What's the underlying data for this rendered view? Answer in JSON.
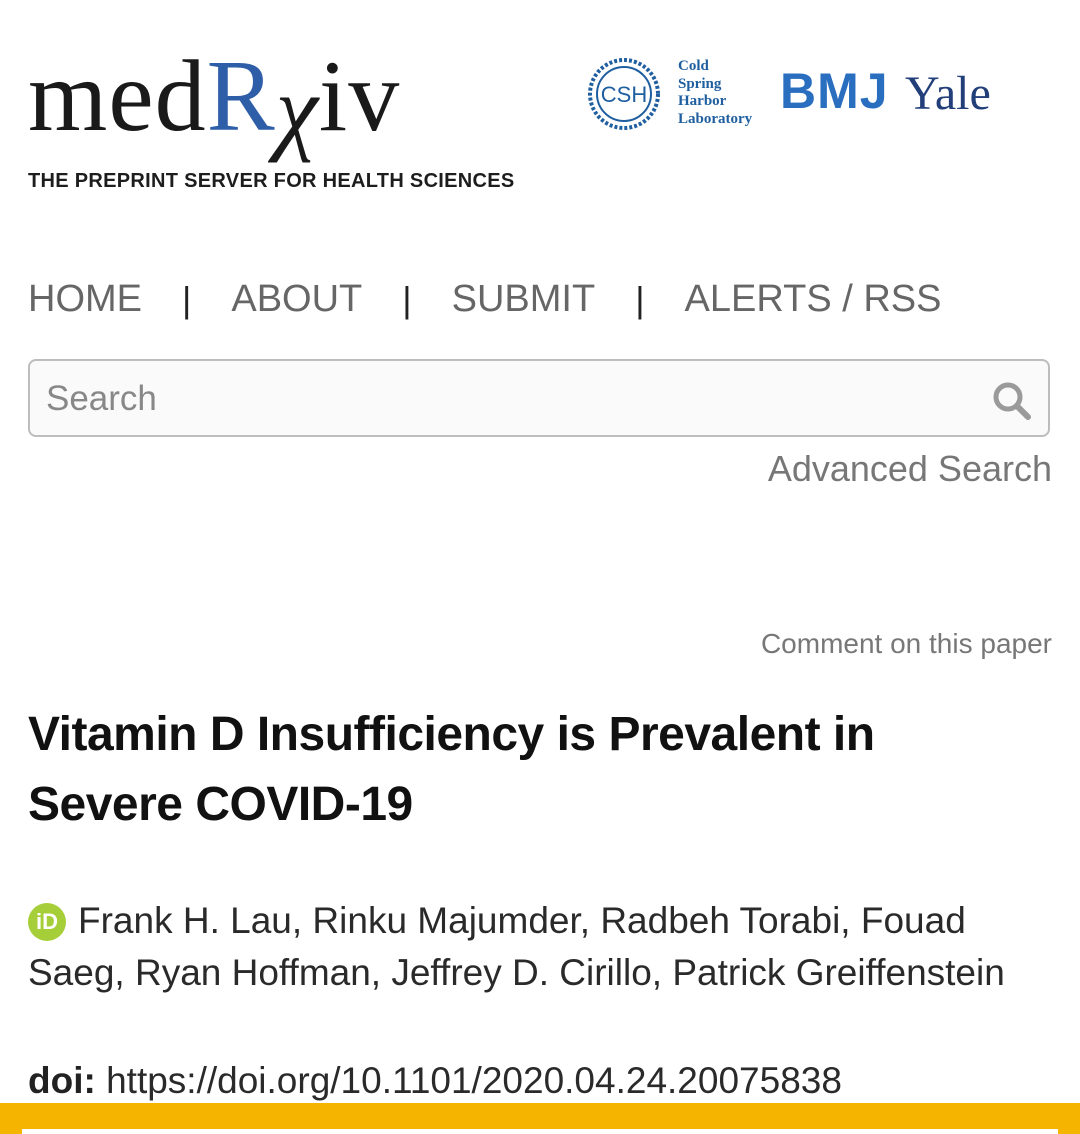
{
  "header": {
    "logo": {
      "med": "med",
      "r": "R",
      "chi": "χ",
      "iv": "iv"
    },
    "tagline": "THE PREPRINT SERVER FOR HEALTH SCIENCES",
    "csh_badge": "CSH",
    "csh_lines": [
      "Cold",
      "Spring",
      "Harbor",
      "Laboratory"
    ],
    "bmj": "BMJ",
    "yale": "Yale"
  },
  "nav": {
    "items": [
      "HOME",
      "ABOUT",
      "SUBMIT",
      "ALERTS / RSS"
    ],
    "separator": "|"
  },
  "search": {
    "placeholder": "Search",
    "value": "",
    "icon": "search-icon",
    "advanced_label": "Advanced Search"
  },
  "paper": {
    "comment_link": "Comment on this paper",
    "title": "Vitamin D Insufficiency is Prevalent in Severe COVID-19",
    "orcid_icon": "iD",
    "authors": "Frank H. Lau, Rinku Majumder, Radbeh Torabi, Fouad Saeg, Ryan Hoffman, Jeffrey D. Cirillo, Patrick Greiffenstein",
    "doi_label": "doi:",
    "doi_value": "https://doi.org/10.1101/2020.04.24.20075838"
  },
  "colors": {
    "brand_blue": "#2f5ea8",
    "orcid_green": "#a6ce39",
    "bottom_bar": "#f5b400"
  }
}
